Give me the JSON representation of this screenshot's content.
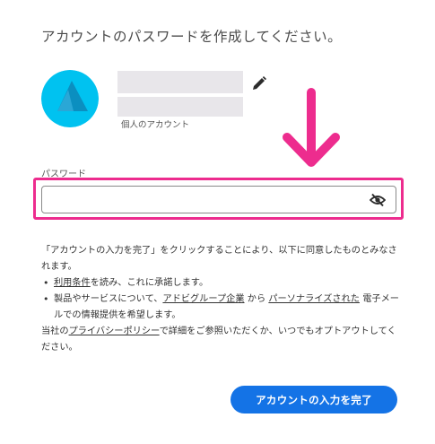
{
  "header": {
    "title": "アカウントのパスワードを作成してください。"
  },
  "profile": {
    "account_type": "個人のアカウント",
    "avatar_color": "#00c2f0"
  },
  "password": {
    "label": "パスワード",
    "value": "",
    "placeholder": ""
  },
  "terms": {
    "intro": "「アカウントの入力を完了」をクリックすることにより、以下に同意したものとみなされます。",
    "item1_link": "利用条件",
    "item1_text": "を読み、これに承諾します。",
    "item2_pre": "製品やサービスについて、",
    "item2_link1": "アドビグループ企業",
    "item2_mid": " から ",
    "item2_link2": "パーソナライズされた",
    "item2_post": " 電子メールでの情報提供を希望します。",
    "privacy_pre": "当社の",
    "privacy_link": "プライバシーポリシー",
    "privacy_post": "で詳細をご参照いただくか、いつでもオプトアウトしてください。"
  },
  "submit_button": {
    "label": "アカウントの入力を完了"
  },
  "colors": {
    "accent": "#1473e6",
    "highlight": "#ed2c8e"
  },
  "icons": {
    "edit": "pencil-icon",
    "visibility": "eye-slash-icon",
    "annotation": "arrow-down-icon"
  }
}
